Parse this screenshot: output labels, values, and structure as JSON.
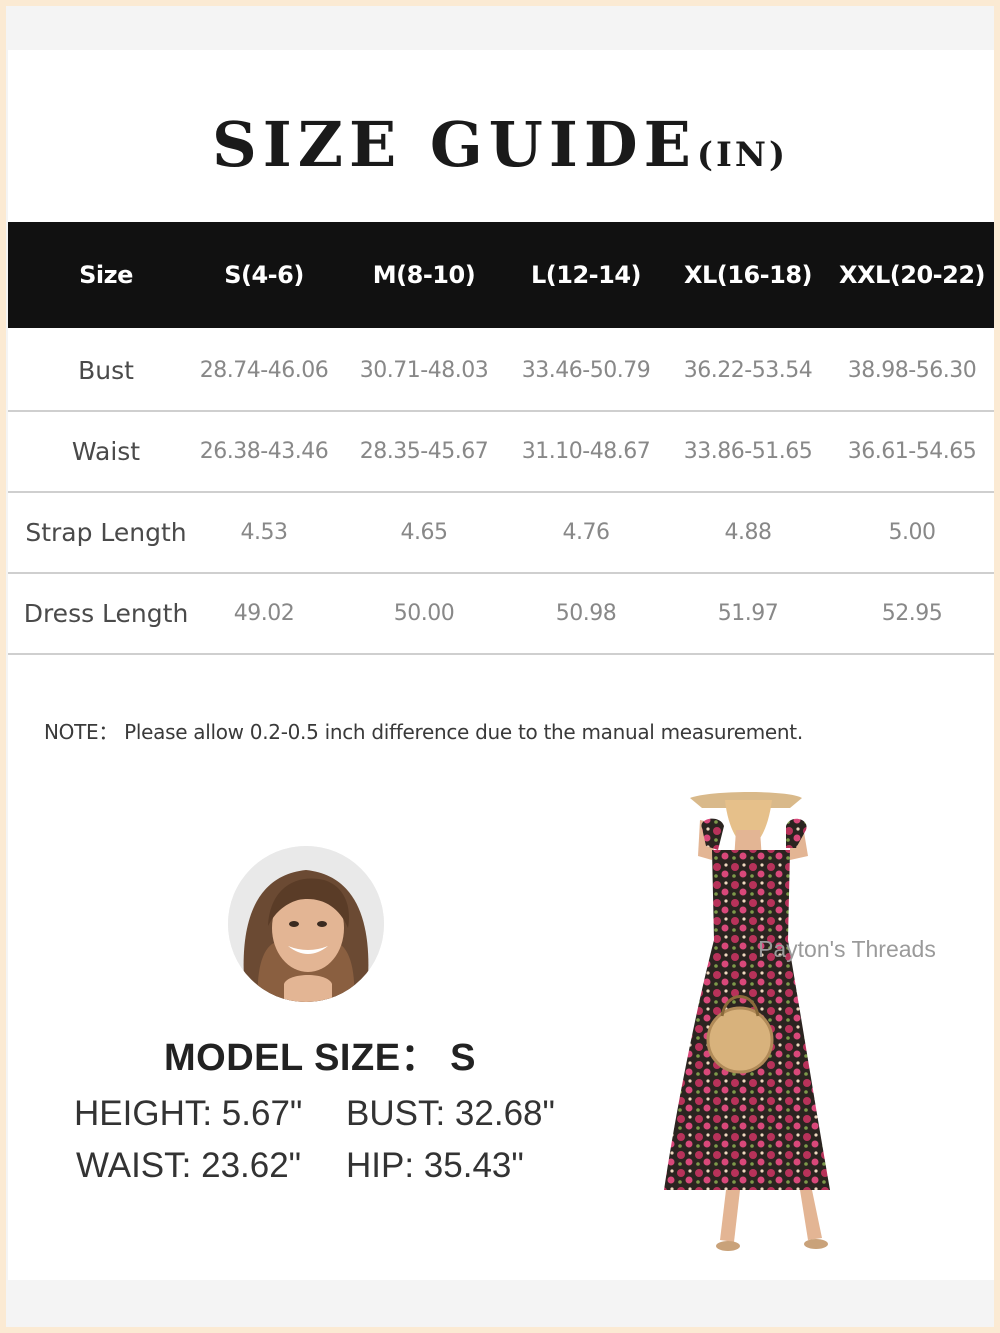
{
  "title": {
    "main": "SIZE GUIDE",
    "unit": "(IN)"
  },
  "table": {
    "header": [
      "Size",
      "S(4-6)",
      "M(8-10)",
      "L(12-14)",
      "XL(16-18)",
      "XXL(20-22)"
    ],
    "rows": [
      {
        "label": "Bust",
        "values": [
          "28.74-46.06",
          "30.71-48.03",
          "33.46-50.79",
          "36.22-53.54",
          "38.98-56.30"
        ]
      },
      {
        "label": "Waist",
        "values": [
          "26.38-43.46",
          "28.35-45.67",
          "31.10-48.67",
          "33.86-51.65",
          "36.61-54.65"
        ]
      },
      {
        "label": "Strap Length",
        "values": [
          "4.53",
          "4.65",
          "4.76",
          "4.88",
          "5.00"
        ]
      },
      {
        "label": "Dress Length",
        "values": [
          "49.02",
          "50.00",
          "50.98",
          "51.97",
          "52.95"
        ]
      }
    ]
  },
  "note": "NOTE： Please allow 0.2-0.5 inch difference due to the manual measurement.",
  "model": {
    "title": "MODEL SIZE： S",
    "height": "HEIGHT: 5.67\"",
    "bust": "BUST: 32.68\"",
    "waist": "WAIST: 23.62\"",
    "hip": "HIP: 35.43\""
  },
  "watermark": "Payton's Threads",
  "colors": {
    "header_bg": "#111111",
    "page_border": "#fbead3",
    "dress_print": "#b8325a"
  }
}
